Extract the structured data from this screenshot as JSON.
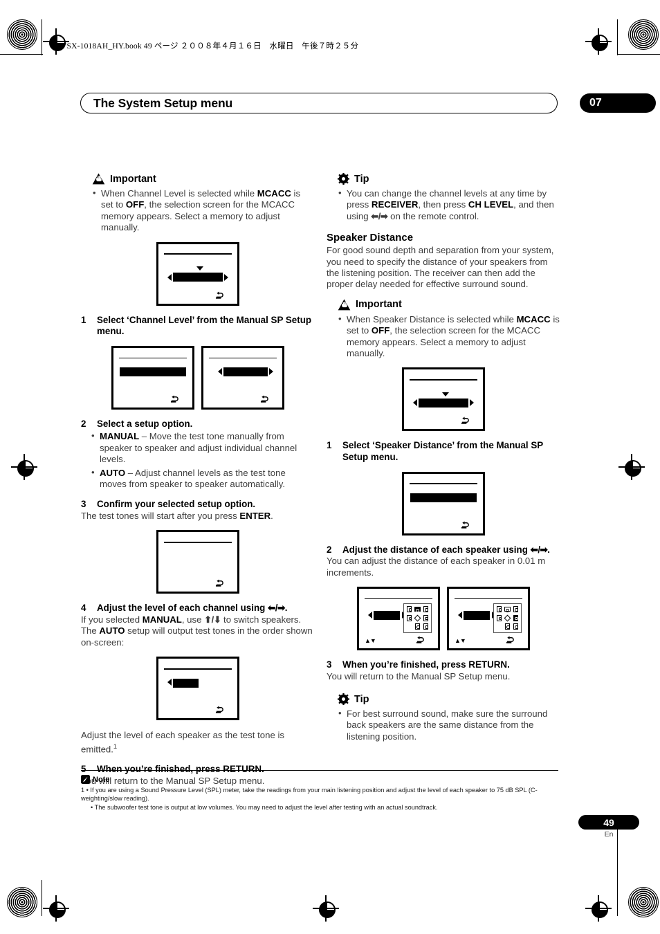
{
  "printer": {
    "book_header": "VSX-1018AH_HY.book   49 ページ   ２００８年４月１６日　水曜日　午後７時２５分"
  },
  "header": {
    "title": "The System Setup menu",
    "chapter": "07"
  },
  "left_column": {
    "important": {
      "icon": "important-icon",
      "label": "Important",
      "bullets": [
        "When Channel Level is selected while <b>MCACC</b> is set to <b>OFF</b>, the selection screen for the MCACC memory appears. Select a memory to adjust manually."
      ]
    },
    "steps": [
      {
        "num": "1",
        "head": "Select ‘Channel Level’ from the Manual SP Setup menu.",
        "body": ""
      },
      {
        "num": "2",
        "head": "Select a setup option.",
        "sub_bullets": [
          "<b>MANUAL</b> – Move the test tone manually from speaker to speaker and adjust individual channel levels.",
          "<b>AUTO</b> – Adjust channel levels as the test tone moves from speaker to speaker automatically."
        ]
      },
      {
        "num": "3",
        "head": "Confirm your selected setup option.",
        "body": "The test tones will start after you press <b>ENTER</b>."
      },
      {
        "num": "4",
        "head": "Adjust the level of each channel using <span class=\"arrow\">⬅/➡</span>.",
        "body": "If you selected <b>MANUAL</b>, use <span class=\"arrow\">⬆/⬇</span> to switch speakers. The <b>AUTO</b> setup will output test tones in the order shown on-screen:"
      },
      {
        "num": "5",
        "head": "When you’re finished, press RETURN.",
        "body": "You will return to the Manual SP Setup menu."
      }
    ],
    "closing_para": "Adjust the level of each speaker as the test tone is emitted.<span class=\"sup\">1</span>"
  },
  "right_column": {
    "tip_top": {
      "icon": "tip-icon",
      "label": "Tip",
      "bullets": [
        "You can change the channel levels at any time by press <b>RECEIVER</b>, then press <b>CH LEVEL</b>, and then using <span class=\"arrow\">⬅/➡</span> on the remote control."
      ]
    },
    "section_title": "Speaker Distance",
    "section_intro": "For good sound depth and separation from your system, you need to specify the distance of your speakers from the listening position. The receiver can then add the proper delay needed for effective surround sound.",
    "important": {
      "icon": "important-icon",
      "label": "Important",
      "bullets": [
        "When Speaker Distance is selected while <b>MCACC</b> is set to <b>OFF</b>, the selection screen for the MCACC memory appears. Select a memory to adjust manually."
      ]
    },
    "steps": [
      {
        "num": "1",
        "head": "Select ‘Speaker Distance’ from the Manual SP Setup menu.",
        "body": ""
      },
      {
        "num": "2",
        "head": "Adjust the distance of each speaker using <span class=\"arrow\">⬅/➡</span>.",
        "body": "You can adjust the distance of each speaker in 0.01 m increments."
      },
      {
        "num": "3",
        "head": "When you’re finished, press RETURN.",
        "body": "You will return to the Manual SP Setup menu."
      }
    ],
    "tip_bottom": {
      "icon": "tip-icon",
      "label": "Tip",
      "bullets": [
        "For best surround sound, make sure the surround back speakers are the same distance from the listening position."
      ]
    }
  },
  "note": {
    "icon": "note-icon",
    "label": "Note",
    "lines": [
      "1 • If you are using a Sound Pressure Level (SPL) meter, take the readings from your main listening position and adjust the level of each speaker to 75 dB SPL (C-weighting/slow reading).",
      "• The subwoofer test tone is output at low volumes. You may need to adjust the level after testing with an actual soundtrack."
    ]
  },
  "footer": {
    "page_number": "49",
    "language": "En"
  }
}
